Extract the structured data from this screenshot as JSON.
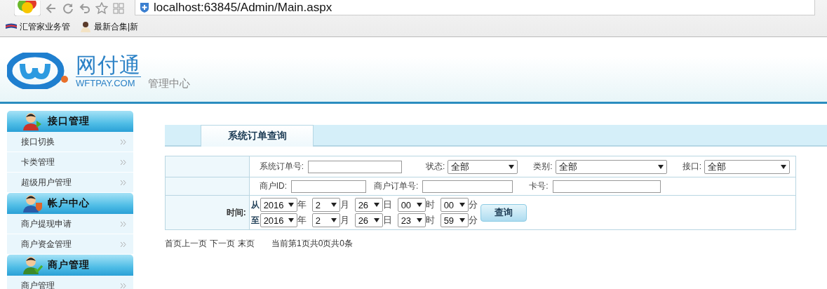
{
  "browser": {
    "url": "localhost:63845/Admin/Main.aspx",
    "bookmarks": [
      "汇管家业务管",
      "最新合集|新"
    ]
  },
  "header": {
    "logo_name": "网付通",
    "logo_domain": "WFTPAY.COM",
    "subtitle": "管理中心"
  },
  "sidebar": {
    "groups": [
      {
        "title": "接口管理",
        "items": [
          "接口切换",
          "卡类管理",
          "超级用户管理"
        ]
      },
      {
        "title": "帐户中心",
        "items": [
          "商户提现申请",
          "商户资金管理"
        ]
      },
      {
        "title": "商户管理",
        "items": [
          "商户管理"
        ]
      }
    ]
  },
  "tabs": [
    {
      "label": "系统订单查询",
      "selected": true
    }
  ],
  "search_form": {
    "rows": [
      [
        {
          "kind": "input",
          "label": "系统订单号:"
        },
        {
          "kind": "select",
          "label": "状态:",
          "value": "全部"
        },
        {
          "kind": "select",
          "label": "类别:",
          "value": "全部"
        },
        {
          "kind": "select",
          "label": "接口:",
          "value": "全部"
        }
      ],
      [
        {
          "kind": "input",
          "label": "商户ID:"
        },
        {
          "kind": "input",
          "label": "商户订单号:"
        },
        {
          "kind": "input",
          "label": "卡号:"
        }
      ]
    ],
    "time": {
      "label": "时间:",
      "ranges": [
        {
          "prefix": "从",
          "parts": [
            {
              "value": "2016",
              "unit": "年"
            },
            {
              "value": "2",
              "unit": "月"
            },
            {
              "value": "26",
              "unit": "日"
            },
            {
              "value": "00",
              "unit": "时"
            },
            {
              "value": "00",
              "unit": "分"
            }
          ]
        },
        {
          "prefix": "至",
          "parts": [
            {
              "value": "2016",
              "unit": "年"
            },
            {
              "value": "2",
              "unit": "月"
            },
            {
              "value": "26",
              "unit": "日"
            },
            {
              "value": "23",
              "unit": "时"
            },
            {
              "value": "59",
              "unit": "分"
            }
          ]
        }
      ],
      "button": "查询"
    }
  },
  "pagination": {
    "links": [
      "首页",
      "上一页",
      "下一页",
      "末页"
    ],
    "info": "当前第1页共0页共0条"
  }
}
